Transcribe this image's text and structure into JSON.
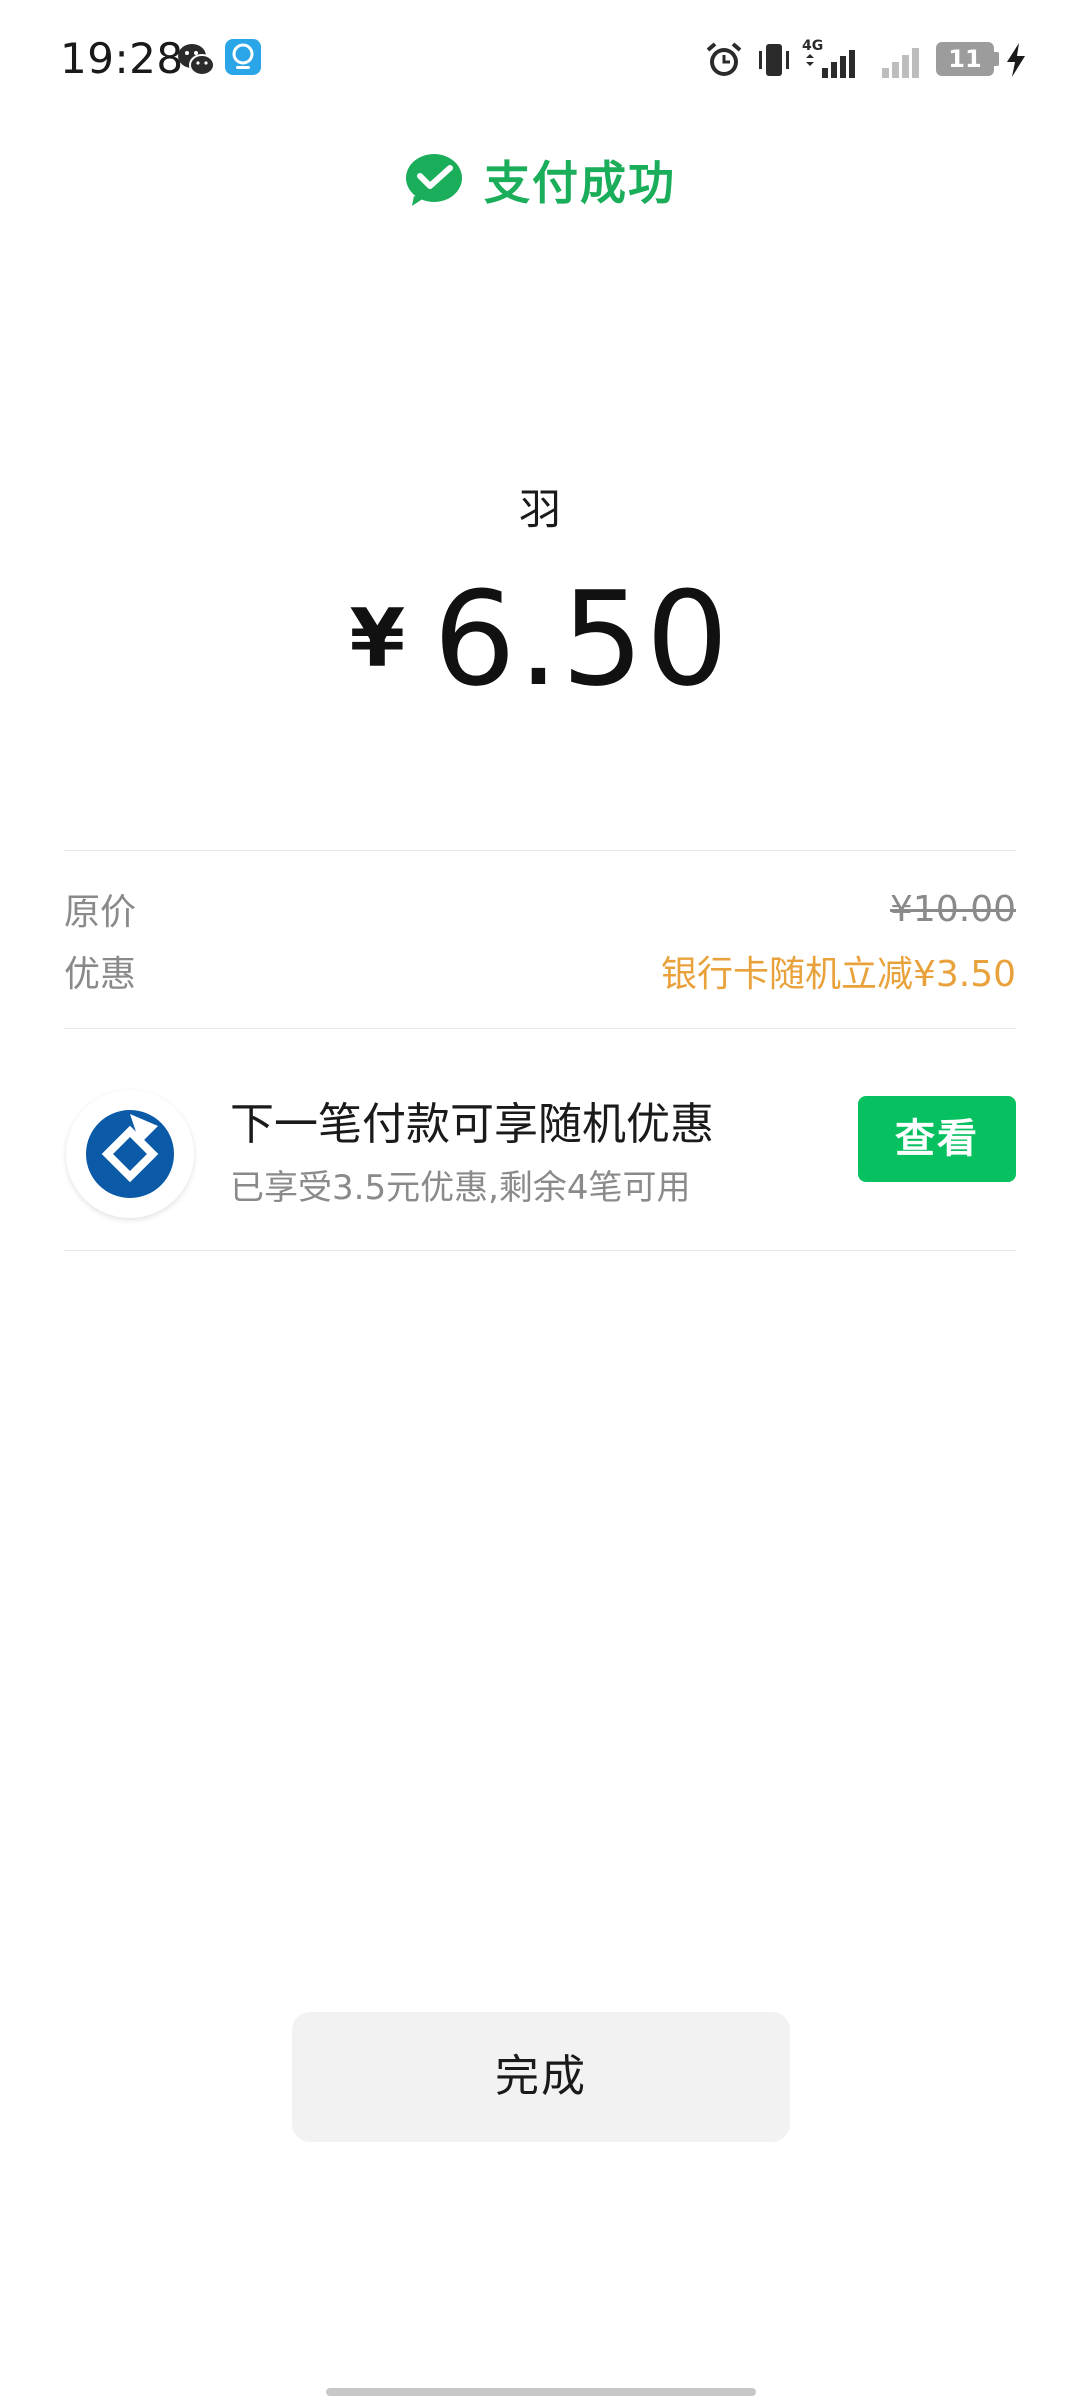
{
  "status_bar": {
    "time": "19:28",
    "network_type": "4G",
    "battery_level": "11",
    "icons": [
      "wechat-icon",
      "app-notification-icon",
      "alarm-icon",
      "vibrate-icon",
      "signal-icon",
      "signal-secondary-icon",
      "battery-icon",
      "charging-bolt-icon"
    ]
  },
  "header": {
    "title": "支付成功",
    "icon": "check-bubble-icon",
    "accent_color": "#1aad5a"
  },
  "payment": {
    "payee": "羽",
    "currency_symbol": "¥",
    "amount": "6.50"
  },
  "price_details": {
    "original_label": "原价",
    "original_value": "¥10.00",
    "discount_label": "优惠",
    "discount_value": "银行卡随机立减¥3.50",
    "discount_color": "#e9a23b"
  },
  "promo": {
    "icon": "bank-logo-icon",
    "title": "下一笔付款可享随机优惠",
    "subtitle": "已享受3.5元优惠,剩余4笔可用",
    "button_label": "查看",
    "button_color": "#07c160"
  },
  "footer": {
    "done_label": "完成"
  }
}
